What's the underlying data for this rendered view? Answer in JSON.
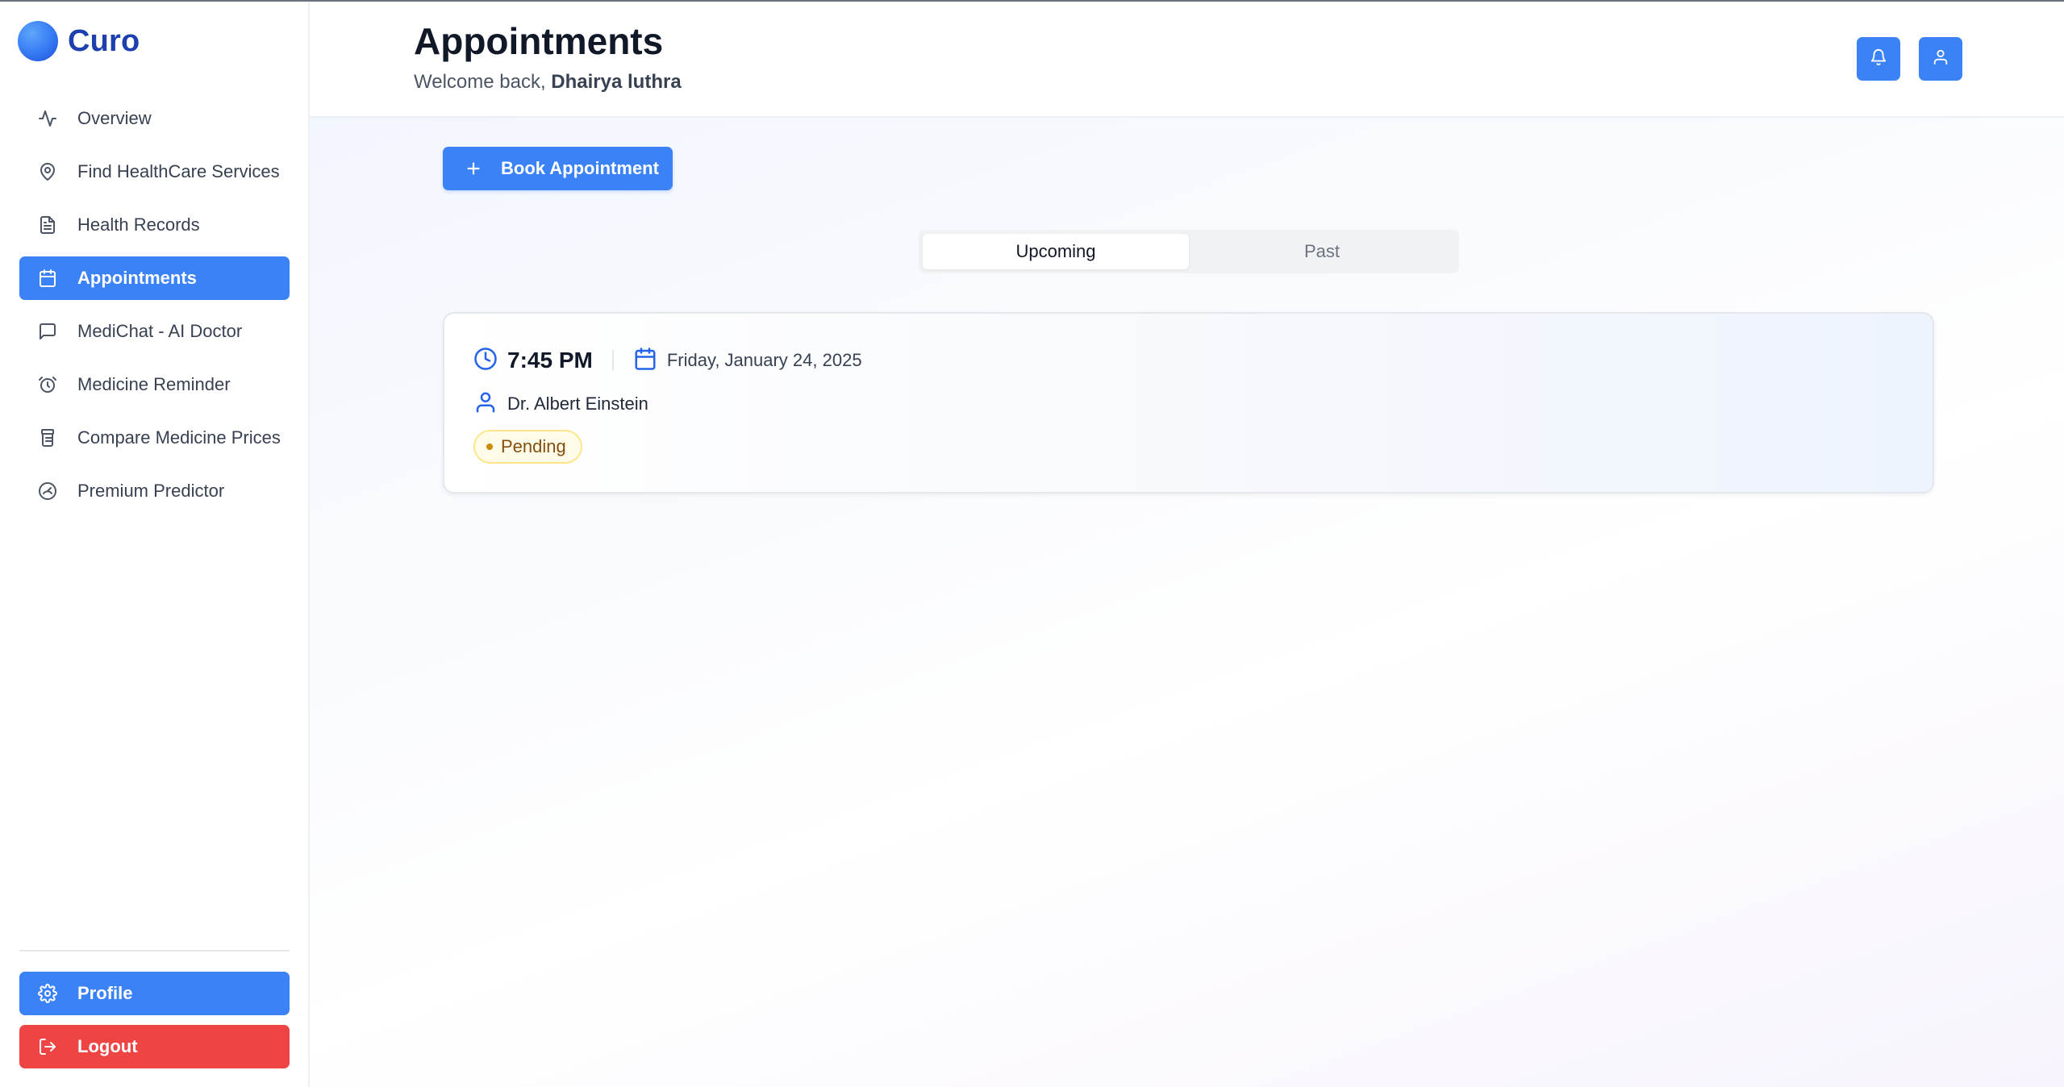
{
  "app": {
    "name": "Curo"
  },
  "sidebar": {
    "items": [
      {
        "label": "Overview",
        "icon": "activity-icon",
        "active": false
      },
      {
        "label": "Find HealthCare Services",
        "icon": "map-pin-icon",
        "active": false
      },
      {
        "label": "Health Records",
        "icon": "file-text-icon",
        "active": false
      },
      {
        "label": "Appointments",
        "icon": "calendar-icon",
        "active": true
      },
      {
        "label": "MediChat - AI Doctor",
        "icon": "message-square-icon",
        "active": false
      },
      {
        "label": "Medicine Reminder",
        "icon": "alarm-clock-icon",
        "active": false
      },
      {
        "label": "Compare Medicine Prices",
        "icon": "pill-bottle-icon",
        "active": false
      },
      {
        "label": "Premium Predictor",
        "icon": "gauge-icon",
        "active": false
      }
    ],
    "profile_label": "Profile",
    "logout_label": "Logout"
  },
  "header": {
    "title": "Appointments",
    "welcome_prefix": "Welcome back,",
    "user_name": "Dhairya luthra"
  },
  "actions": {
    "book_label": "Book Appointment"
  },
  "tabs": [
    {
      "label": "Upcoming",
      "active": true
    },
    {
      "label": "Past",
      "active": false
    }
  ],
  "appointments": [
    {
      "time": "7:45 PM",
      "date": "Friday, January 24, 2025",
      "doctor": "Dr. Albert Einstein",
      "status": "Pending"
    }
  ],
  "colors": {
    "primary": "#3b82f6",
    "danger": "#ef4444",
    "brand_text": "#1e40af",
    "pending_bg": "#fefce8",
    "pending_text": "#854d0e"
  }
}
